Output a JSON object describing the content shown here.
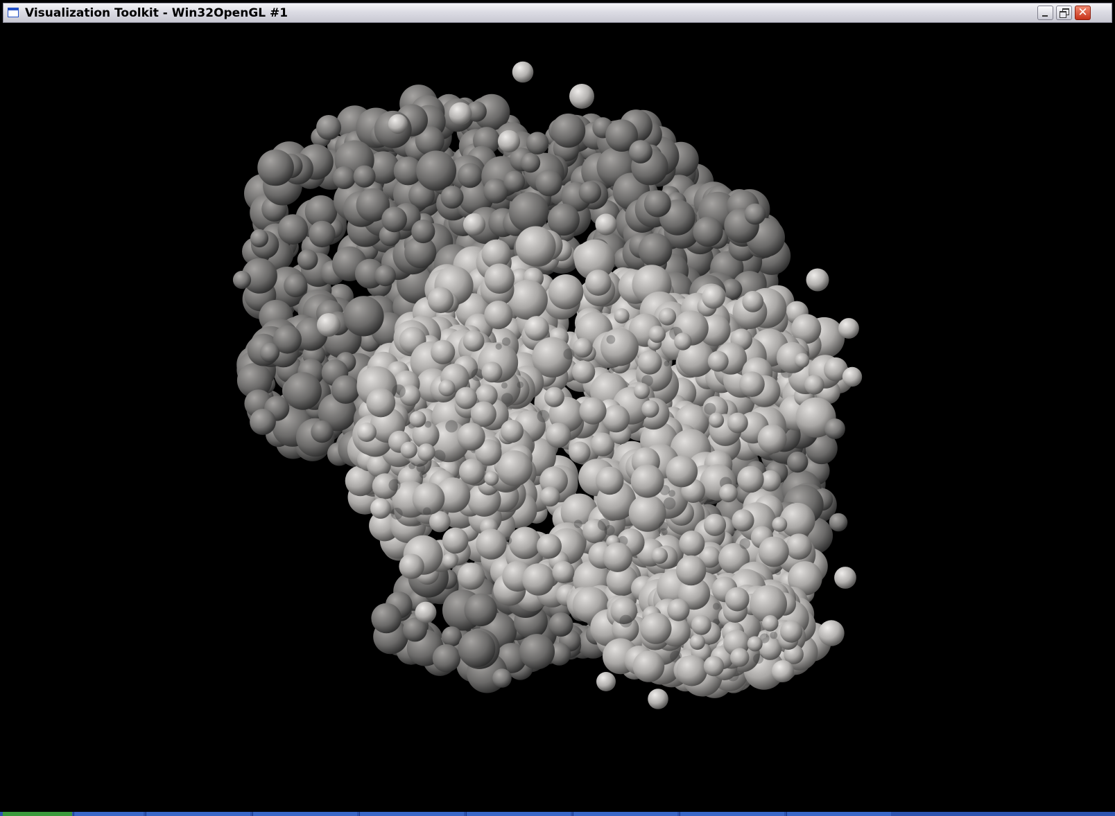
{
  "window": {
    "title": "Visualization Toolkit - Win32OpenGL #1",
    "icon": "vtk-window-icon",
    "controls": {
      "minimize_icon": "minimize-icon",
      "restore_icon": "restore-icon",
      "close_icon": "close-icon",
      "close_glyph": "✕"
    }
  },
  "viewport": {
    "background_color": "#000000",
    "object": "protein-molecular-surface",
    "surface_color": "#b8b6b4"
  },
  "colors": {
    "titlebar": "#dcdce4",
    "close_button": "#c7321a",
    "taskbar": "#2e54b0",
    "start_button": "#3c9a3c"
  }
}
